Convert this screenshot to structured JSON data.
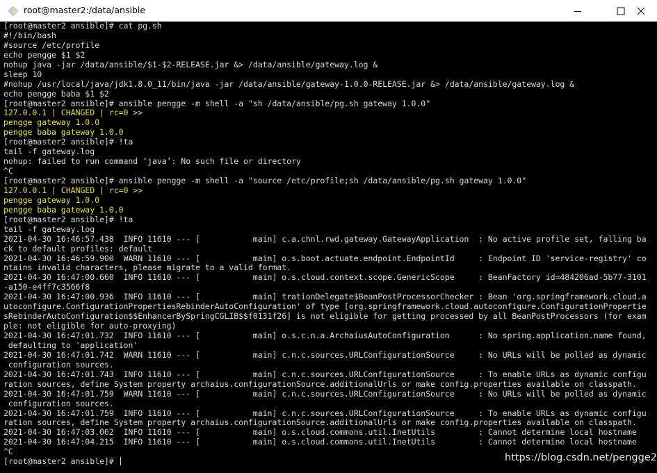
{
  "window": {
    "title": "root@master2:/data/ansible",
    "app_icon": "putty-diamond-icon",
    "controls": {
      "minimize_icon": "minimize-icon",
      "maximize_icon": "maximize-icon",
      "close_icon": "close-icon"
    }
  },
  "colors": {
    "terminal_bg": "#000000",
    "terminal_fg": "#d9d9d9",
    "ansible_output": "#e8e03a"
  },
  "terminal": {
    "lines": [
      {
        "text": "[root@master2 ansible]# cat pg.sh",
        "style": "normal"
      },
      {
        "text": "#!/bin/bash",
        "style": "normal"
      },
      {
        "text": "#source /etc/profile",
        "style": "normal"
      },
      {
        "text": "echo pengge $1 $2",
        "style": "normal"
      },
      {
        "text": "nohup java -jar /data/ansible/$1-$2-RELEASE.jar &> /data/ansible/gateway.log &",
        "style": "normal"
      },
      {
        "text": "sleep 10",
        "style": "normal"
      },
      {
        "text": "#nohup /usr/local/java/jdk1.8.0_11/bin/java -jar /data/ansible/gateway-1.0.0-RELEASE.jar &> /data/ansible/gateway.log &",
        "style": "normal"
      },
      {
        "text": "echo pengge baba $1 $2",
        "style": "normal"
      },
      {
        "text": "[root@master2 ansible]# ansible pengge -m shell -a \"sh /data/ansible/pg.sh gateway 1.0.0\"",
        "style": "normal"
      },
      {
        "text": "127.0.0.1 | CHANGED | rc=0 >>",
        "style": "yellow"
      },
      {
        "text": "pengge gateway 1.0.0",
        "style": "yellow"
      },
      {
        "text": "pengge baba gateway 1.0.0",
        "style": "yellow"
      },
      {
        "text": "[root@master2 ansible]# !ta",
        "style": "normal"
      },
      {
        "text": "tail -f gateway.log",
        "style": "normal"
      },
      {
        "text": "nohup: failed to run command ‘java’: No such file or directory",
        "style": "normal"
      },
      {
        "text": "^C",
        "style": "normal"
      },
      {
        "text": "[root@master2 ansible]# ansible pengge -m shell -a \"source /etc/profile;sh /data/ansible/pg.sh gateway 1.0.0\"",
        "style": "normal"
      },
      {
        "text": "127.0.0.1 | CHANGED | rc=0 >>",
        "style": "yellow"
      },
      {
        "text": "pengge gateway 1.0.0",
        "style": "yellow"
      },
      {
        "text": "pengge baba gateway 1.0.0",
        "style": "yellow"
      },
      {
        "text": "[root@master2 ansible]# !ta",
        "style": "normal"
      },
      {
        "text": "tail -f gateway.log",
        "style": "normal"
      },
      {
        "text": "2021-04-30 16:46:57.438  INFO 11610 --- [           main] c.a.chnl.rwd.gateway.GatewayApplication  : No active profile set, falling ba",
        "style": "normal"
      },
      {
        "text": "ck to default profiles: default",
        "style": "normal"
      },
      {
        "text": "2021-04-30 16:46:59.900  WARN 11610 --- [           main] o.s.boot.actuate.endpoint.EndpointId     : Endpoint ID 'service-registry' co",
        "style": "normal"
      },
      {
        "text": "ntains invalid characters, please migrate to a valid format.",
        "style": "normal"
      },
      {
        "text": "2021-04-30 16:47:00.660  INFO 11610 --- [           main] o.s.cloud.context.scope.GenericScope     : BeanFactory id=484206ad-5b77-3101",
        "style": "normal"
      },
      {
        "text": "-a150-e4ff7c3566f8",
        "style": "normal"
      },
      {
        "text": "2021-04-30 16:47:00.936  INFO 11610 --- [           main] trationDelegate$BeanPostProcessorChecker : Bean 'org.springframework.cloud.a",
        "style": "normal"
      },
      {
        "text": "utoconfigure.ConfigurationPropertiesRebinderAutoConfiguration' of type [org.springframework.cloud.autoconfigure.ConfigurationPropertie",
        "style": "normal"
      },
      {
        "text": "sRebinderAutoConfiguration$$EnhancerBySpringCGLIB$$f0131f26] is not eligible for getting processed by all BeanPostProcessors (for exam",
        "style": "normal"
      },
      {
        "text": "ple: not eligible for auto-proxying)",
        "style": "normal"
      },
      {
        "text": "2021-04-30 16:47:01.732  INFO 11610 --- [           main] o.s.c.n.a.ArchaiusAutoConfiguration      : No spring.application.name found,",
        "style": "normal"
      },
      {
        "text": " defaulting to 'application'",
        "style": "normal"
      },
      {
        "text": "2021-04-30 16:47:01.742  WARN 11610 --- [           main] c.n.c.sources.URLConfigurationSource     : No URLs will be polled as dynamic",
        "style": "normal"
      },
      {
        "text": " configuration sources.",
        "style": "normal"
      },
      {
        "text": "2021-04-30 16:47:01.743  INFO 11610 --- [           main] c.n.c.sources.URLConfigurationSource     : To enable URLs as dynamic configu",
        "style": "normal"
      },
      {
        "text": "ration sources, define System property archaius.configurationSource.additionalUrls or make config.properties available on classpath.",
        "style": "normal"
      },
      {
        "text": "2021-04-30 16:47:01.759  WARN 11610 --- [           main] c.n.c.sources.URLConfigurationSource     : No URLs will be polled as dynamic",
        "style": "normal"
      },
      {
        "text": " configuration sources.",
        "style": "normal"
      },
      {
        "text": "2021-04-30 16:47:01.759  INFO 11610 --- [           main] c.n.c.sources.URLConfigurationSource     : To enable URLs as dynamic configu",
        "style": "normal"
      },
      {
        "text": "ration sources, define System property archaius.configurationSource.additionalUrls or make config.properties available on classpath.",
        "style": "normal"
      },
      {
        "text": "2021-04-30 16:47:03.062  INFO 11610 --- [           main] o.s.cloud.commons.util.InetUtils         : Cannot determine local hostname",
        "style": "normal"
      },
      {
        "text": "2021-04-30 16:47:04.215  INFO 11610 --- [           main] o.s.cloud.commons.util.InetUtils         : Cannot determine local hostname",
        "style": "normal"
      },
      {
        "text": "^C",
        "style": "normal"
      },
      {
        "text": "[root@master2 ansible]# ",
        "style": "normal",
        "cursor": true
      }
    ]
  },
  "watermark": "https://blog.csdn.net/pengge2"
}
